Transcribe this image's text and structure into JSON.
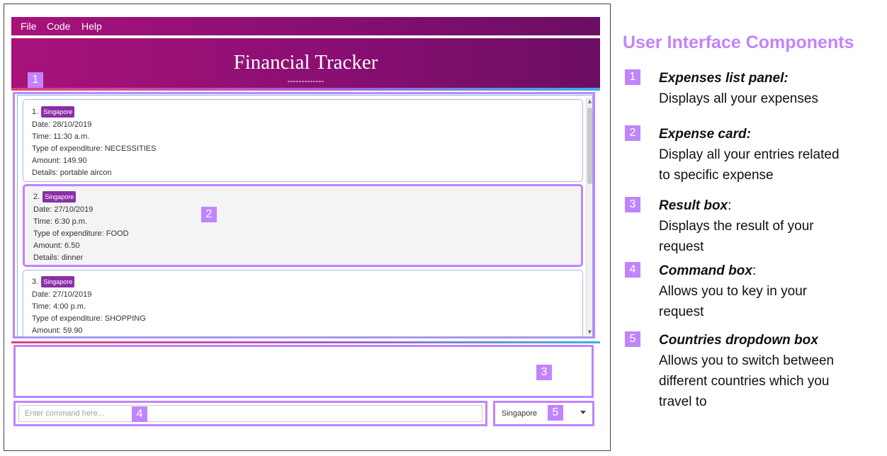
{
  "menu": {
    "file": "File",
    "code": "Code",
    "help": "Help"
  },
  "header": {
    "title": "Financial Tracker",
    "dashes": "-------------"
  },
  "expenses": [
    {
      "index": "1.",
      "country": "Singapore",
      "date": "Date: 28/10/2019",
      "time": "Time: 11:30 a.m.",
      "type": "Type of expenditure: NECESSITIES",
      "amount": "Amount: 149.90",
      "details": "Details: portable aircon"
    },
    {
      "index": "2.",
      "country": "Singapore",
      "date": "Date: 27/10/2019",
      "time": "Time: 6:30 p.m.",
      "type": "Type of expenditure: FOOD",
      "amount": "Amount: 6.50",
      "details": "Details: dinner"
    },
    {
      "index": "3.",
      "country": "Singapore",
      "date": "Date: 27/10/2019",
      "time": "Time: 4:00 p.m.",
      "type": "Type of expenditure: SHOPPING",
      "amount": "Amount: 59.90"
    }
  ],
  "command": {
    "placeholder": "Enter command here..."
  },
  "country_dropdown": {
    "selected": "Singapore"
  },
  "callouts": {
    "one": "1",
    "two": "2",
    "three": "3",
    "four": "4",
    "five": "5"
  },
  "legend": {
    "title": "User Interface Components",
    "items": [
      {
        "num": "1",
        "name": "Expenses list panel:",
        "desc_lines": [
          "Displays all your expenses"
        ]
      },
      {
        "num": "2",
        "name": "Expense card:",
        "desc_lines": [
          "Display all your entries related",
          "to specific expense"
        ]
      },
      {
        "num": "3",
        "name": "Result box",
        "suffix": ":",
        "desc_lines": [
          "Displays the result of your",
          "request"
        ]
      },
      {
        "num": "4",
        "name": "Command box",
        "suffix": ":",
        "desc_lines": [
          "Allows you to key in your",
          "request"
        ]
      },
      {
        "num": "5",
        "name": "Countries dropdown box",
        "desc_lines": [
          "Allows you to switch between",
          "different countries which you",
          "travel to"
        ]
      }
    ]
  },
  "colors": {
    "accent": "#c084fc",
    "header_start": "#a8127a",
    "header_end": "#6b0d63",
    "country_tag": "#8a2fa8"
  }
}
